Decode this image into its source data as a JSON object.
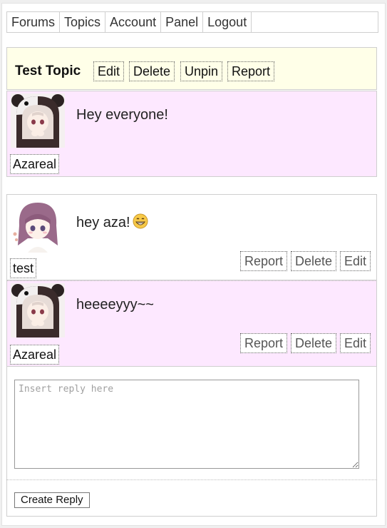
{
  "nav": {
    "items": [
      "Forums",
      "Topics",
      "Account",
      "Panel",
      "Logout"
    ]
  },
  "topic": {
    "title": "Test Topic",
    "actions": [
      "Edit",
      "Delete",
      "Unpin",
      "Report"
    ]
  },
  "posts": [
    {
      "author": "Azareal",
      "text": "Hey everyone!",
      "avatar": "anime-girl-bear-hood"
    },
    {
      "author": "test",
      "text": "hey aza!",
      "emoji": "grinning-emoji",
      "avatar": "anime-girl-purple-hair",
      "actions": [
        "Report",
        "Delete",
        "Edit"
      ]
    },
    {
      "author": "Azareal",
      "text": "heeeeyyy~~",
      "avatar": "anime-girl-bear-hood",
      "actions": [
        "Report",
        "Delete",
        "Edit"
      ]
    }
  ],
  "reply": {
    "placeholder": "Insert reply here",
    "submit_label": "Create Reply"
  },
  "colors": {
    "topic_header_bg": "#ffffe8",
    "post_pink_bg": "#fde8ff"
  }
}
